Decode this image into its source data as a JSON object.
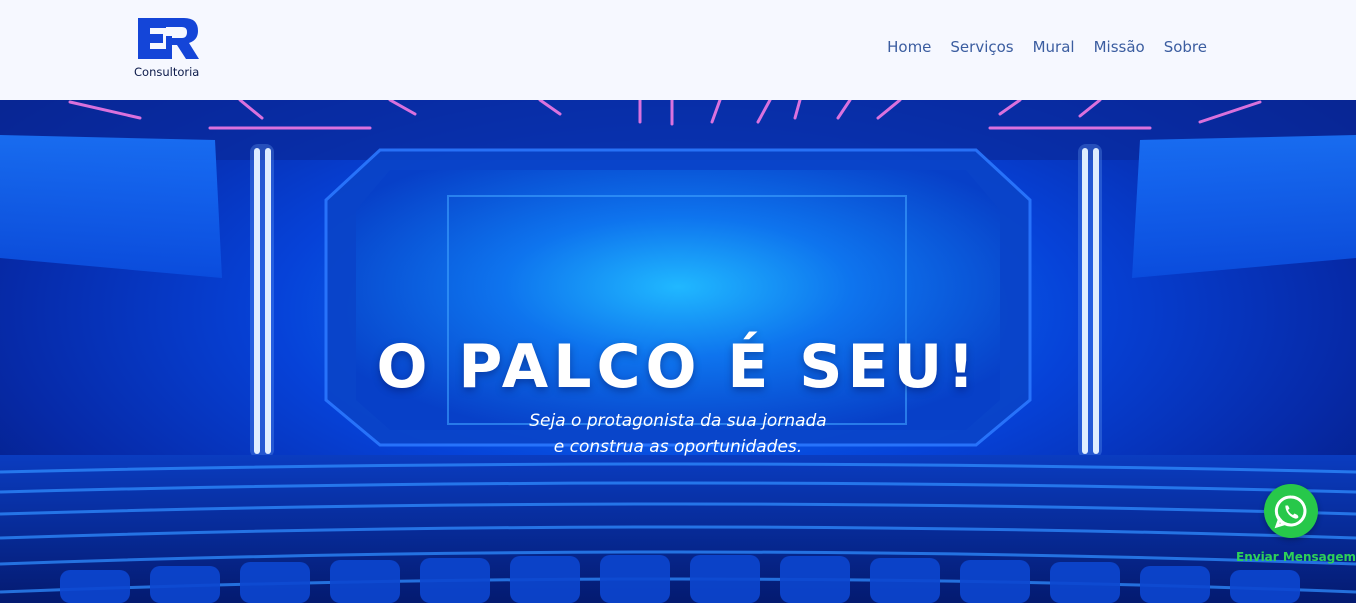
{
  "header": {
    "logo_mark": "ER",
    "logo_subtitle": "Consultoria",
    "nav": [
      {
        "label": "Home"
      },
      {
        "label": "Serviços"
      },
      {
        "label": "Mural"
      },
      {
        "label": "Missão"
      },
      {
        "label": "Sobre"
      }
    ]
  },
  "hero": {
    "headline": "O PALCO É SEU!",
    "subline_1": "Seja o protagonista da sua jornada",
    "subline_2": "e construa as oportunidades."
  },
  "whatsapp": {
    "icon": "whatsapp-icon",
    "label": "Enviar Mensagem"
  },
  "colors": {
    "brand_blue": "#1445d8",
    "nav_text": "#3b5da0",
    "whatsapp_green": "#27c84a"
  }
}
